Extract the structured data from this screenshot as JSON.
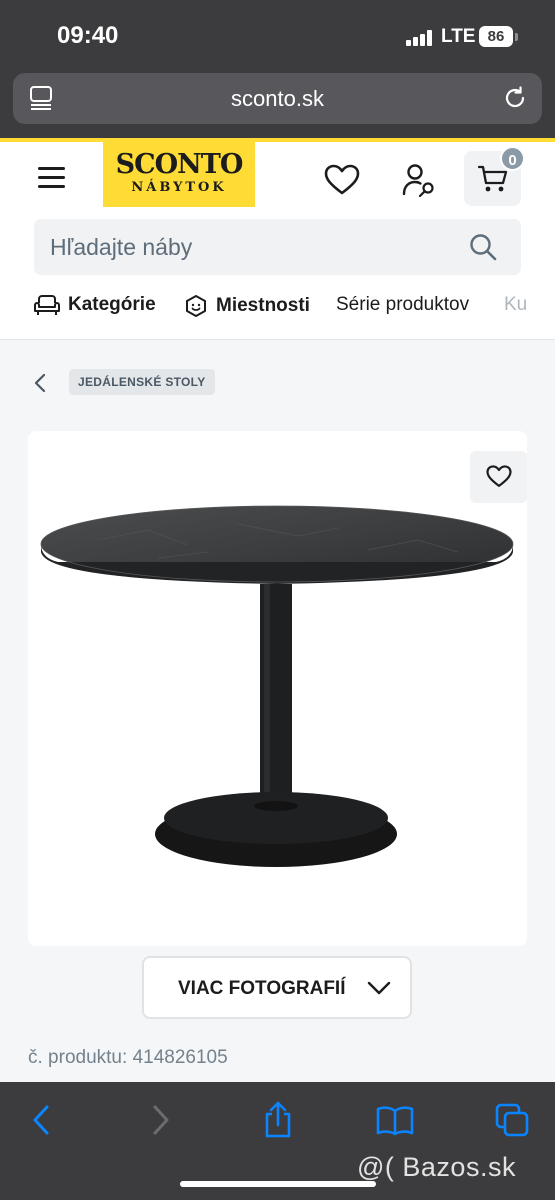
{
  "status_bar": {
    "time": "09:40",
    "network": "LTE",
    "battery": "86"
  },
  "browser": {
    "url": "sconto.sk"
  },
  "header": {
    "logo_main": "SCONTO",
    "logo_sub": "NÁBYTOK",
    "cart_count": "0",
    "search_placeholder": "Hľadajte náby"
  },
  "nav": {
    "items": [
      {
        "label": "Kategórie",
        "icon": "sofa-icon"
      },
      {
        "label": "Miestnosti",
        "icon": "smiley-box-icon"
      },
      {
        "label": "Série produktov"
      },
      {
        "label": "Ku"
      }
    ]
  },
  "breadcrumb": {
    "label": "JEDÁLENSKÉ STOLY"
  },
  "product": {
    "image_alt": "round dining table",
    "more_photos_label": "VIAC FOTOGRAFIÍ",
    "number_label": "č. produktu:",
    "number_value": "414826105"
  },
  "watermark": "@( Bazos.sk",
  "colors": {
    "brand_yellow": "#ffdc35",
    "chrome": "#3c3c3e",
    "link_blue": "#0a84ff"
  }
}
